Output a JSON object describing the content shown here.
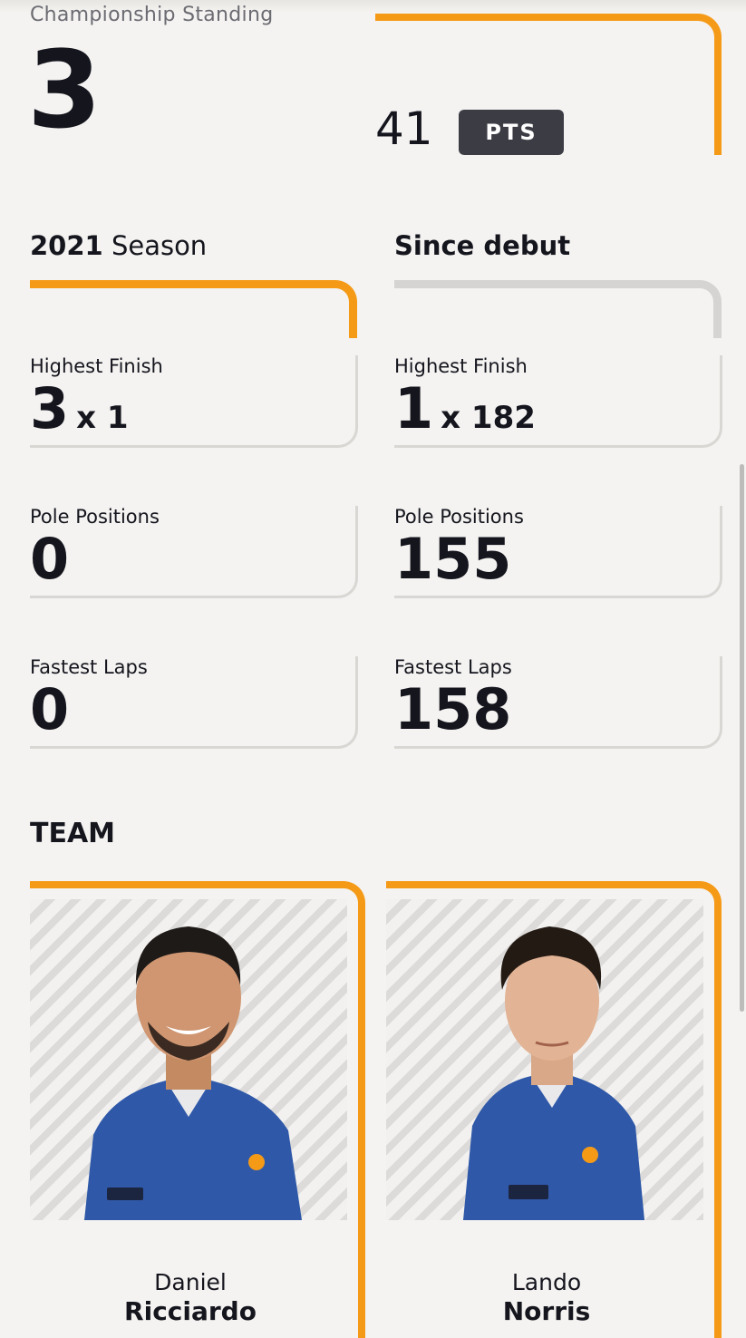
{
  "championship": {
    "label": "Championship Standing",
    "position": "3",
    "points": "41",
    "points_unit": "PTS"
  },
  "season": {
    "year": "2021",
    "word": "Season",
    "stats": [
      {
        "label": "Highest Finish",
        "value": "3",
        "suffix": "x 1"
      },
      {
        "label": "Pole Positions",
        "value": "0",
        "suffix": ""
      },
      {
        "label": "Fastest Laps",
        "value": "0",
        "suffix": ""
      }
    ]
  },
  "debut": {
    "title": "Since debut",
    "stats": [
      {
        "label": "Highest Finish",
        "value": "1",
        "suffix": "x 182"
      },
      {
        "label": "Pole Positions",
        "value": "155",
        "suffix": ""
      },
      {
        "label": "Fastest Laps",
        "value": "158",
        "suffix": ""
      }
    ]
  },
  "team": {
    "title": "TEAM",
    "drivers": [
      {
        "first": "Daniel",
        "last": "Ricciardo"
      },
      {
        "first": "Lando",
        "last": "Norris"
      }
    ]
  },
  "colors": {
    "accent": "#f59a17",
    "text": "#15151e",
    "badge": "#3c3c45",
    "suit": "#2f58a8"
  }
}
